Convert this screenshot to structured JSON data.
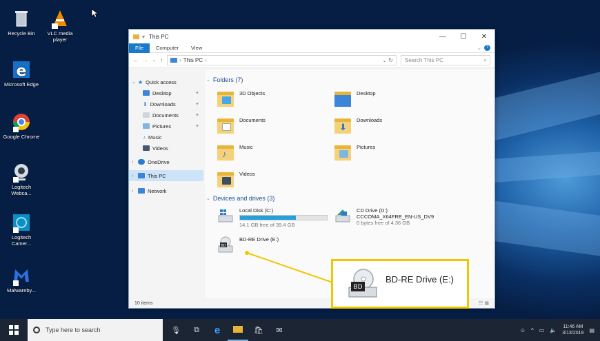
{
  "desktop": {
    "icons": [
      {
        "label": "Recycle Bin",
        "icon": "recycle-bin-icon"
      },
      {
        "label": "VLC media player",
        "icon": "vlc-icon"
      },
      {
        "label": "Microsoft Edge",
        "icon": "edge-icon"
      },
      {
        "label": "Google Chrome",
        "icon": "chrome-icon"
      },
      {
        "label": "Logitech Webca...",
        "icon": "webcam-icon"
      },
      {
        "label": "Logitech Camer...",
        "icon": "camera-icon"
      },
      {
        "label": "Malwareby...",
        "icon": "malwarebytes-icon"
      }
    ]
  },
  "window": {
    "title": "This PC",
    "controls": {
      "minimize": "—",
      "maximize": "☐",
      "close": "✕"
    },
    "ribbon_tabs": [
      "File",
      "Computer",
      "View"
    ],
    "address": "This PC",
    "search_placeholder": "Search This PC",
    "nav": {
      "quick_access": "Quick access",
      "pinned": [
        "Desktop",
        "Downloads",
        "Documents",
        "Pictures"
      ],
      "unpinned": [
        "Music",
        "Videos"
      ],
      "onedrive": "OneDrive",
      "this_pc": "This PC",
      "network": "Network"
    },
    "folders_header": "Folders (7)",
    "folders": [
      {
        "name": "3D Objects",
        "icon": "3d-objects-icon"
      },
      {
        "name": "Desktop",
        "icon": "desktop-folder-icon"
      },
      {
        "name": "Documents",
        "icon": "documents-folder-icon"
      },
      {
        "name": "Downloads",
        "icon": "downloads-folder-icon"
      },
      {
        "name": "Music",
        "icon": "music-folder-icon"
      },
      {
        "name": "Pictures",
        "icon": "pictures-folder-icon"
      },
      {
        "name": "Videos",
        "icon": "videos-folder-icon"
      }
    ],
    "drives_header": "Devices and drives (3)",
    "drives": {
      "local": {
        "name": "Local Disk (C:)",
        "free": "14.1 GB free of 39.4 GB",
        "used_fraction": 0.64
      },
      "cd": {
        "name": "CD Drive (D:)",
        "volume": "CCCOMA_X64FRE_EN-US_DV9",
        "free": "0 bytes free of 4.36 GB"
      },
      "bd": {
        "name": "BD-RE Drive (E:)",
        "badge": "BD"
      }
    },
    "status": "10 items"
  },
  "callout": {
    "label": "BD-RE Drive (E:)",
    "badge": "BD",
    "color": "#f2c700"
  },
  "taskbar": {
    "search_placeholder": "Type here to search",
    "time": "11:46 AM",
    "date": "3/13/2019"
  }
}
